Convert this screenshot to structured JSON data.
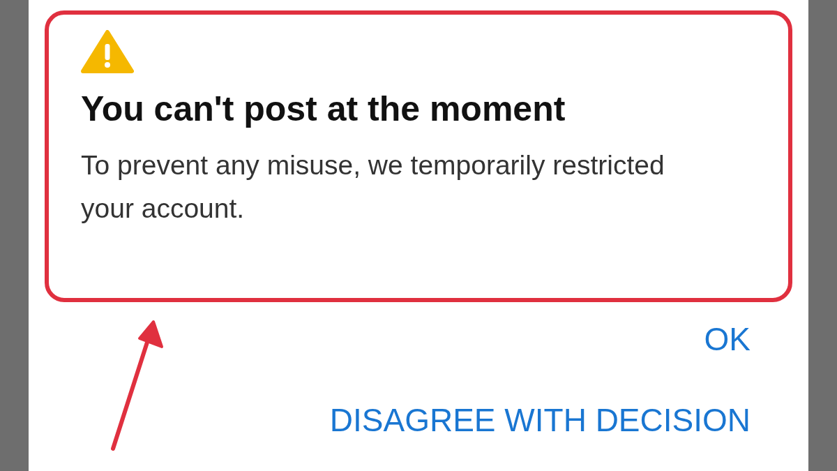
{
  "dialog": {
    "title": "You can't post at the moment",
    "message": "To prevent any misuse, we temporarily restricted your account.",
    "buttons": [
      "OK",
      "DISAGREE WITH DECISION"
    ]
  }
}
